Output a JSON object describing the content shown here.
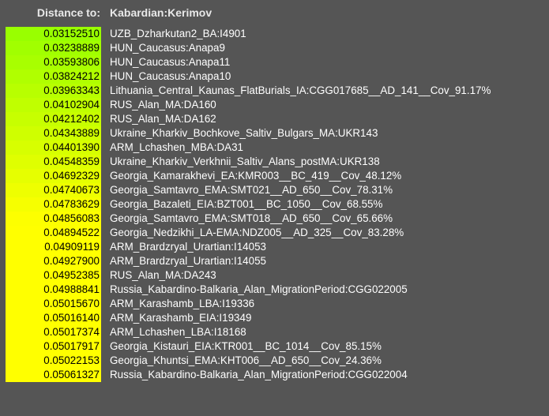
{
  "header": {
    "label": "Distance to:",
    "target": "Kabardian:Kerimov"
  },
  "gradient": {
    "start": "#99ff00",
    "end": "#ffff00"
  },
  "rows": [
    {
      "distance": "0.03152510",
      "population": "UZB_Dzharkutan2_BA:I4901"
    },
    {
      "distance": "0.03238889",
      "population": "HUN_Caucasus:Anapa9"
    },
    {
      "distance": "0.03593806",
      "population": "HUN_Caucasus:Anapa11"
    },
    {
      "distance": "0.03824212",
      "population": "HUN_Caucasus:Anapa10"
    },
    {
      "distance": "0.03963343",
      "population": "Lithuania_Central_Kaunas_FlatBurials_IA:CGG017685__AD_141__Cov_91.17%"
    },
    {
      "distance": "0.04102904",
      "population": "RUS_Alan_MA:DA160"
    },
    {
      "distance": "0.04212402",
      "population": "RUS_Alan_MA:DA162"
    },
    {
      "distance": "0.04343889",
      "population": "Ukraine_Kharkiv_Bochkove_Saltiv_Bulgars_MA:UKR143"
    },
    {
      "distance": "0.04401390",
      "population": "ARM_Lchashen_MBA:DA31"
    },
    {
      "distance": "0.04548359",
      "population": "Ukraine_Kharkiv_Verkhnii_Saltiv_Alans_postMA:UKR138"
    },
    {
      "distance": "0.04692329",
      "population": "Georgia_Kamarakhevi_EA:KMR003__BC_419__Cov_48.12%"
    },
    {
      "distance": "0.04740673",
      "population": "Georgia_Samtavro_EMA:SMT021__AD_650__Cov_78.31%"
    },
    {
      "distance": "0.04783629",
      "population": "Georgia_Bazaleti_EIA:BZT001__BC_1050__Cov_68.55%"
    },
    {
      "distance": "0.04856083",
      "population": "Georgia_Samtavro_EMA:SMT018__AD_650__Cov_65.66%"
    },
    {
      "distance": "0.04894522",
      "population": "Georgia_Nedzikhi_LA-EMA:NDZ005__AD_325__Cov_83.28%"
    },
    {
      "distance": "0.04909119",
      "population": "ARM_Brardzryal_Urartian:I14053"
    },
    {
      "distance": "0.04927900",
      "population": "ARM_Brardzryal_Urartian:I14055"
    },
    {
      "distance": "0.04952385",
      "population": "RUS_Alan_MA:DA243"
    },
    {
      "distance": "0.04988841",
      "population": "Russia_Kabardino-Balkaria_Alan_MigrationPeriod:CGG022005"
    },
    {
      "distance": "0.05015670",
      "population": "ARM_Karashamb_LBA:I19336"
    },
    {
      "distance": "0.05016140",
      "population": "ARM_Karashamb_EIA:I19349"
    },
    {
      "distance": "0.05017374",
      "population": "ARM_Lchashen_LBA:I18168"
    },
    {
      "distance": "0.05017917",
      "population": "Georgia_Kistauri_EIA:KTR001__BC_1014__Cov_85.15%"
    },
    {
      "distance": "0.05022153",
      "population": "Georgia_Khuntsi_EMA:KHT006__AD_650__Cov_24.36%"
    },
    {
      "distance": "0.05061327",
      "population": "Russia_Kabardino-Balkaria_Alan_MigrationPeriod:CGG022004"
    }
  ]
}
